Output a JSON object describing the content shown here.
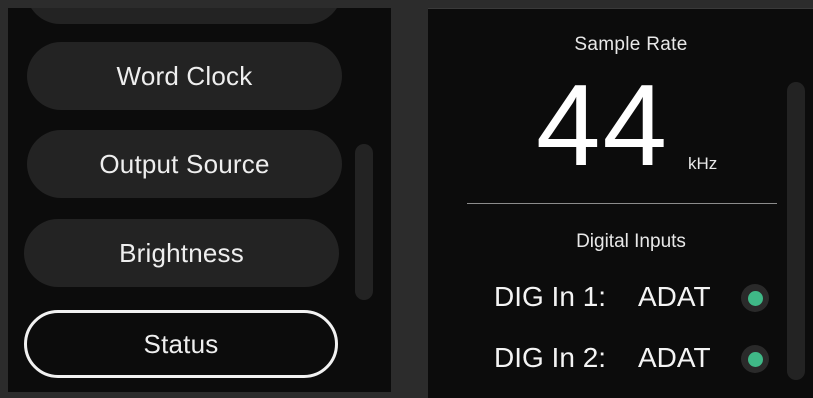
{
  "menu": {
    "items": [
      {
        "label": "Word Clock"
      },
      {
        "label": "Output Source"
      },
      {
        "label": "Brightness"
      },
      {
        "label": "Status",
        "selected": true
      }
    ]
  },
  "status_panel": {
    "sample_rate_label": "Sample Rate",
    "sample_rate_value": "44",
    "sample_rate_unit": "kHz",
    "digital_inputs_label": "Digital Inputs",
    "digital_inputs": [
      {
        "name": "DIG In 1:",
        "format": "ADAT",
        "status_color": "#3fb987"
      },
      {
        "name": "DIG In 2:",
        "format": "ADAT",
        "status_color": "#3fb987"
      }
    ]
  },
  "colors": {
    "background": "#2c2c2c",
    "panel": "#0c0c0c",
    "button": "#232323",
    "accent_green": "#3fb987",
    "selected_border": "#f2f2f2"
  }
}
